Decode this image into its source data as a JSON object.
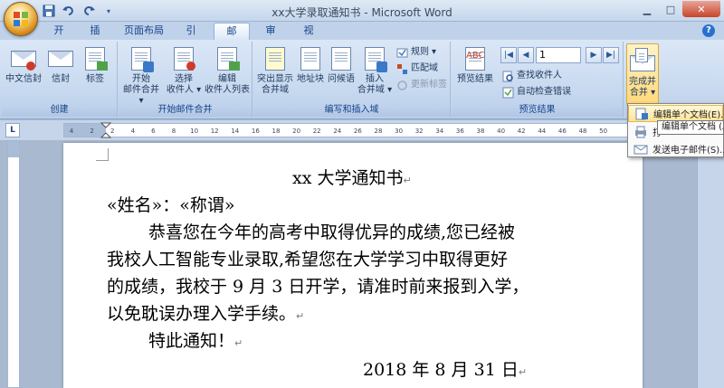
{
  "window": {
    "title": "xx大学录取通知书 - Microsoft Word",
    "min": "▁",
    "max": "□",
    "close": "✕"
  },
  "quick_access": [
    "save-icon",
    "undo-icon",
    "redo-icon"
  ],
  "tabs": [
    {
      "label": "开始"
    },
    {
      "label": "插入"
    },
    {
      "label": "页面布局"
    },
    {
      "label": "引用"
    },
    {
      "label": "邮件",
      "active": true
    },
    {
      "label": "审阅"
    },
    {
      "label": "视图"
    }
  ],
  "ribbon": {
    "create": {
      "label": "创建",
      "envelope": "中文信封",
      "envelopes": "信封",
      "labels": "标签"
    },
    "start_merge": {
      "label": "开始邮件合并",
      "start_line1": "开始",
      "start_line2": "邮件合并",
      "select_line1": "选择",
      "select_line2": "收件人",
      "edit_line1": "编辑",
      "edit_line2": "收件人列表"
    },
    "write_insert": {
      "label": "编写和插入域",
      "highlight_line1": "突出显示",
      "highlight_line2": "合并域",
      "address_block": "地址块",
      "greeting": "问候语",
      "insert_line1": "插入",
      "insert_line2": "合并域",
      "rules": "规则",
      "match": "匹配域",
      "update": "更新标签"
    },
    "preview": {
      "label": "预览结果",
      "preview_btn": "预览结果",
      "record": "1",
      "find": "查找收件人",
      "auto_check": "自动检查错误"
    },
    "finish": {
      "line1": "完成并",
      "line2": "合并"
    }
  },
  "dropdown": {
    "items": [
      {
        "label": "编辑单个文档(E)..."
      },
      {
        "label": "打"
      },
      {
        "label": "发送电子邮件(S)..."
      }
    ],
    "tooltip": "编辑单个文档 (A"
  },
  "ruler": {
    "corner": "L",
    "ticks": [
      "4",
      "2",
      "2",
      "4",
      "6",
      "8",
      "10",
      "12",
      "14",
      "16",
      "18",
      "20",
      "22",
      "24",
      "26",
      "28",
      "30",
      "32",
      "34",
      "36",
      "38",
      "40",
      "42",
      "44",
      "46",
      "48",
      "50"
    ]
  },
  "document": {
    "title": "xx 大学通知书",
    "greeting": "«姓名»：«称谓»",
    "para_line1": "恭喜您在今年的高考中取得优异的成绩,您已经被",
    "para_line2": "我校人工智能专业录取,希望您在大学学习中取得更好",
    "para_line3": "的成绩，我校于 9 月 3 日开学，请准时前来报到入学，",
    "para_line4": "以免耽误办理入学手续。",
    "closing": "特此通知！",
    "date": "2018 年 8 月 31 日",
    "para_mark": "↵"
  }
}
